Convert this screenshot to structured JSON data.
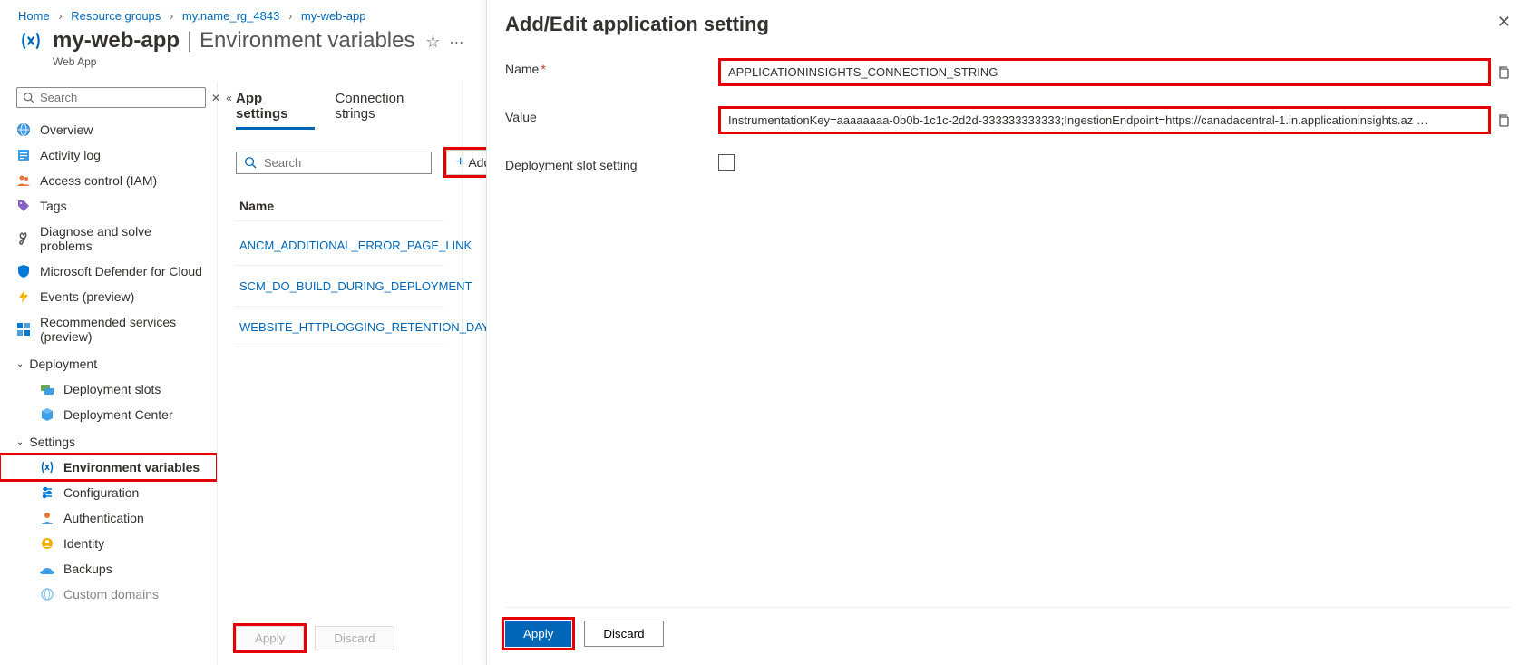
{
  "breadcrumb": [
    "Home",
    "Resource groups",
    "my.name_rg_4843",
    "my-web-app"
  ],
  "header": {
    "title": "my-web-app",
    "section": "Environment variables",
    "subtitle": "Web App"
  },
  "sidebar": {
    "search_placeholder": "Search",
    "items": [
      {
        "icon": "globe",
        "label": "Overview"
      },
      {
        "icon": "log",
        "label": "Activity log"
      },
      {
        "icon": "people",
        "label": "Access control (IAM)"
      },
      {
        "icon": "tag",
        "label": "Tags"
      },
      {
        "icon": "wrench",
        "label": "Diagnose and solve problems"
      },
      {
        "icon": "shield",
        "label": "Microsoft Defender for Cloud"
      },
      {
        "icon": "bolt",
        "label": "Events (preview)"
      },
      {
        "icon": "grid",
        "label": "Recommended services (preview)"
      }
    ],
    "sections": [
      {
        "label": "Deployment",
        "children": [
          {
            "icon": "slots",
            "label": "Deployment slots"
          },
          {
            "icon": "cube",
            "label": "Deployment Center"
          }
        ]
      },
      {
        "label": "Settings",
        "children": [
          {
            "icon": "env",
            "label": "Environment variables",
            "active": true
          },
          {
            "icon": "config",
            "label": "Configuration"
          },
          {
            "icon": "auth",
            "label": "Authentication"
          },
          {
            "icon": "identity",
            "label": "Identity"
          },
          {
            "icon": "backup",
            "label": "Backups"
          },
          {
            "icon": "domain",
            "label": "Custom domains"
          }
        ]
      }
    ]
  },
  "main": {
    "tabs": [
      "App settings",
      "Connection strings"
    ],
    "filter_placeholder": "Search",
    "add_label": "Add",
    "name_header": "Name",
    "settings": [
      "ANCM_ADDITIONAL_ERROR_PAGE_LINK",
      "SCM_DO_BUILD_DURING_DEPLOYMENT",
      "WEBSITE_HTTPLOGGING_RETENTION_DAYS"
    ],
    "apply_label": "Apply",
    "discard_label": "Discard"
  },
  "panel": {
    "title": "Add/Edit application setting",
    "name_label": "Name",
    "name_value": "APPLICATIONINSIGHTS_CONNECTION_STRING",
    "value_label": "Value",
    "value_value": "InstrumentationKey=aaaaaaaa-0b0b-1c1c-2d2d-333333333333;IngestionEndpoint=https://canadacentral-1.in.applicationinsights.az …",
    "slot_label": "Deployment slot setting",
    "apply_label": "Apply",
    "discard_label": "Discard"
  }
}
